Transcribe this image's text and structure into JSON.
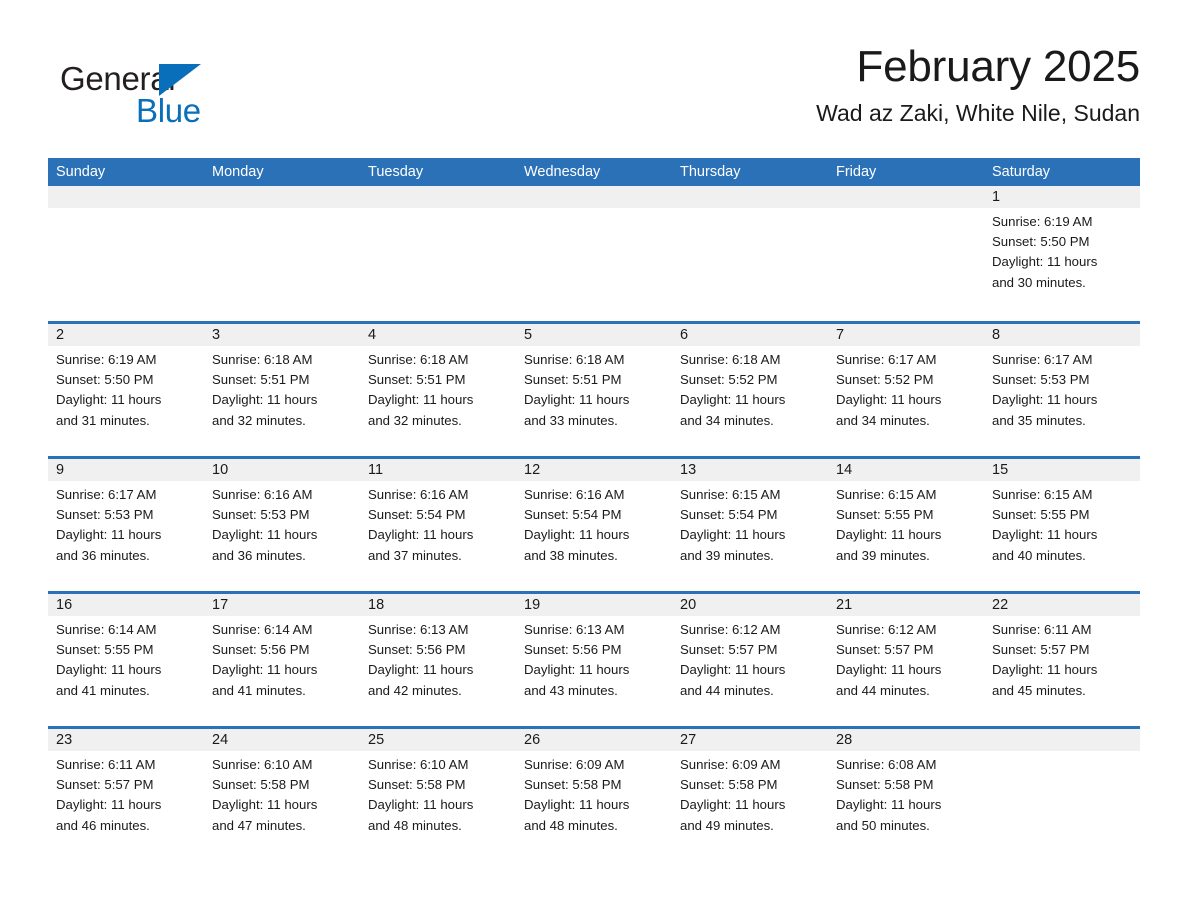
{
  "brand": {
    "name_part1": "General",
    "name_part2": "Blue",
    "accent_color": "#0a6fba"
  },
  "header": {
    "month_title": "February 2025",
    "location": "Wad az Zaki, White Nile, Sudan"
  },
  "calendar": {
    "header_color": "#2b71b8",
    "weekdays": [
      "Sunday",
      "Monday",
      "Tuesday",
      "Wednesday",
      "Thursday",
      "Friday",
      "Saturday"
    ],
    "weeks": [
      [
        {
          "day": "",
          "lines": []
        },
        {
          "day": "",
          "lines": []
        },
        {
          "day": "",
          "lines": []
        },
        {
          "day": "",
          "lines": []
        },
        {
          "day": "",
          "lines": []
        },
        {
          "day": "",
          "lines": []
        },
        {
          "day": "1",
          "lines": [
            "Sunrise: 6:19 AM",
            "Sunset: 5:50 PM",
            "Daylight: 11 hours",
            "and 30 minutes."
          ]
        }
      ],
      [
        {
          "day": "2",
          "lines": [
            "Sunrise: 6:19 AM",
            "Sunset: 5:50 PM",
            "Daylight: 11 hours",
            "and 31 minutes."
          ]
        },
        {
          "day": "3",
          "lines": [
            "Sunrise: 6:18 AM",
            "Sunset: 5:51 PM",
            "Daylight: 11 hours",
            "and 32 minutes."
          ]
        },
        {
          "day": "4",
          "lines": [
            "Sunrise: 6:18 AM",
            "Sunset: 5:51 PM",
            "Daylight: 11 hours",
            "and 32 minutes."
          ]
        },
        {
          "day": "5",
          "lines": [
            "Sunrise: 6:18 AM",
            "Sunset: 5:51 PM",
            "Daylight: 11 hours",
            "and 33 minutes."
          ]
        },
        {
          "day": "6",
          "lines": [
            "Sunrise: 6:18 AM",
            "Sunset: 5:52 PM",
            "Daylight: 11 hours",
            "and 34 minutes."
          ]
        },
        {
          "day": "7",
          "lines": [
            "Sunrise: 6:17 AM",
            "Sunset: 5:52 PM",
            "Daylight: 11 hours",
            "and 34 minutes."
          ]
        },
        {
          "day": "8",
          "lines": [
            "Sunrise: 6:17 AM",
            "Sunset: 5:53 PM",
            "Daylight: 11 hours",
            "and 35 minutes."
          ]
        }
      ],
      [
        {
          "day": "9",
          "lines": [
            "Sunrise: 6:17 AM",
            "Sunset: 5:53 PM",
            "Daylight: 11 hours",
            "and 36 minutes."
          ]
        },
        {
          "day": "10",
          "lines": [
            "Sunrise: 6:16 AM",
            "Sunset: 5:53 PM",
            "Daylight: 11 hours",
            "and 36 minutes."
          ]
        },
        {
          "day": "11",
          "lines": [
            "Sunrise: 6:16 AM",
            "Sunset: 5:54 PM",
            "Daylight: 11 hours",
            "and 37 minutes."
          ]
        },
        {
          "day": "12",
          "lines": [
            "Sunrise: 6:16 AM",
            "Sunset: 5:54 PM",
            "Daylight: 11 hours",
            "and 38 minutes."
          ]
        },
        {
          "day": "13",
          "lines": [
            "Sunrise: 6:15 AM",
            "Sunset: 5:54 PM",
            "Daylight: 11 hours",
            "and 39 minutes."
          ]
        },
        {
          "day": "14",
          "lines": [
            "Sunrise: 6:15 AM",
            "Sunset: 5:55 PM",
            "Daylight: 11 hours",
            "and 39 minutes."
          ]
        },
        {
          "day": "15",
          "lines": [
            "Sunrise: 6:15 AM",
            "Sunset: 5:55 PM",
            "Daylight: 11 hours",
            "and 40 minutes."
          ]
        }
      ],
      [
        {
          "day": "16",
          "lines": [
            "Sunrise: 6:14 AM",
            "Sunset: 5:55 PM",
            "Daylight: 11 hours",
            "and 41 minutes."
          ]
        },
        {
          "day": "17",
          "lines": [
            "Sunrise: 6:14 AM",
            "Sunset: 5:56 PM",
            "Daylight: 11 hours",
            "and 41 minutes."
          ]
        },
        {
          "day": "18",
          "lines": [
            "Sunrise: 6:13 AM",
            "Sunset: 5:56 PM",
            "Daylight: 11 hours",
            "and 42 minutes."
          ]
        },
        {
          "day": "19",
          "lines": [
            "Sunrise: 6:13 AM",
            "Sunset: 5:56 PM",
            "Daylight: 11 hours",
            "and 43 minutes."
          ]
        },
        {
          "day": "20",
          "lines": [
            "Sunrise: 6:12 AM",
            "Sunset: 5:57 PM",
            "Daylight: 11 hours",
            "and 44 minutes."
          ]
        },
        {
          "day": "21",
          "lines": [
            "Sunrise: 6:12 AM",
            "Sunset: 5:57 PM",
            "Daylight: 11 hours",
            "and 44 minutes."
          ]
        },
        {
          "day": "22",
          "lines": [
            "Sunrise: 6:11 AM",
            "Sunset: 5:57 PM",
            "Daylight: 11 hours",
            "and 45 minutes."
          ]
        }
      ],
      [
        {
          "day": "23",
          "lines": [
            "Sunrise: 6:11 AM",
            "Sunset: 5:57 PM",
            "Daylight: 11 hours",
            "and 46 minutes."
          ]
        },
        {
          "day": "24",
          "lines": [
            "Sunrise: 6:10 AM",
            "Sunset: 5:58 PM",
            "Daylight: 11 hours",
            "and 47 minutes."
          ]
        },
        {
          "day": "25",
          "lines": [
            "Sunrise: 6:10 AM",
            "Sunset: 5:58 PM",
            "Daylight: 11 hours",
            "and 48 minutes."
          ]
        },
        {
          "day": "26",
          "lines": [
            "Sunrise: 6:09 AM",
            "Sunset: 5:58 PM",
            "Daylight: 11 hours",
            "and 48 minutes."
          ]
        },
        {
          "day": "27",
          "lines": [
            "Sunrise: 6:09 AM",
            "Sunset: 5:58 PM",
            "Daylight: 11 hours",
            "and 49 minutes."
          ]
        },
        {
          "day": "28",
          "lines": [
            "Sunrise: 6:08 AM",
            "Sunset: 5:58 PM",
            "Daylight: 11 hours",
            "and 50 minutes."
          ]
        },
        {
          "day": "",
          "lines": []
        }
      ]
    ]
  }
}
